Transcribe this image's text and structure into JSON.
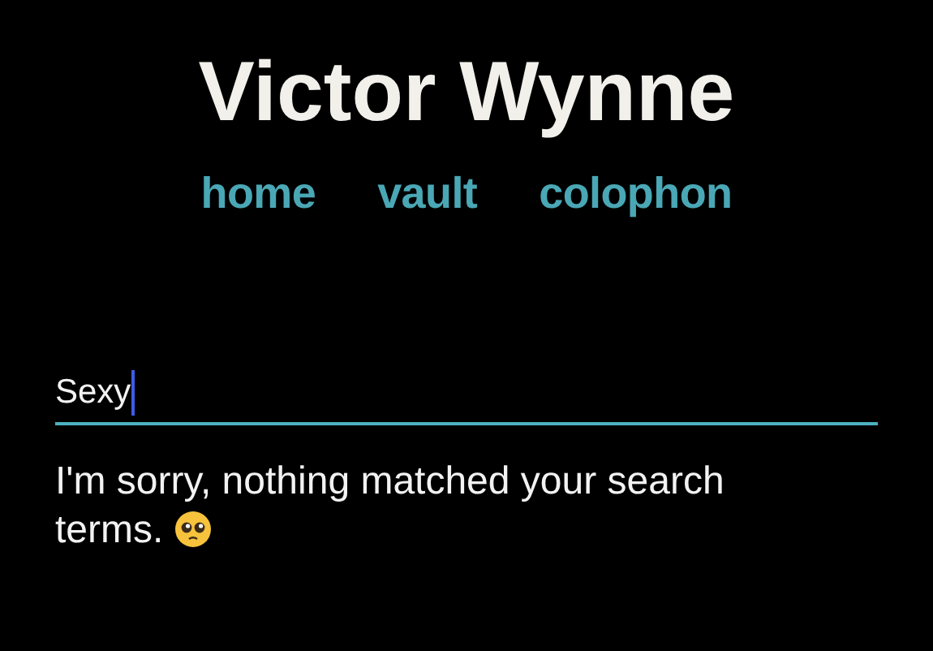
{
  "site_title": "Victor Wynne",
  "nav": [
    {
      "label": "home"
    },
    {
      "label": "vault"
    },
    {
      "label": "colophon"
    }
  ],
  "search": {
    "value": "Sexy",
    "focused": true
  },
  "message": "I'm sorry, nothing matched your search terms."
}
